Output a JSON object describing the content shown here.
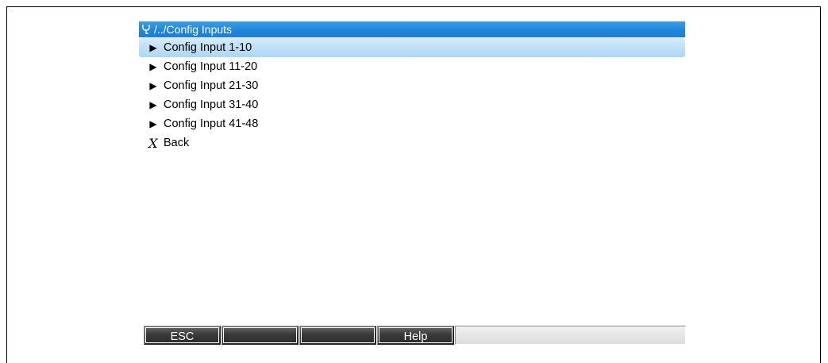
{
  "header": {
    "path": "/../Config Inputs",
    "icon": "wrench-icon"
  },
  "menu": {
    "items": [
      {
        "label": "Config Input 1-10",
        "icon": "submenu-arrow-icon",
        "selected": true
      },
      {
        "label": "Config Input 11-20",
        "icon": "submenu-arrow-icon",
        "selected": false
      },
      {
        "label": "Config Input 21-30",
        "icon": "submenu-arrow-icon",
        "selected": false
      },
      {
        "label": "Config Input 31-40",
        "icon": "submenu-arrow-icon",
        "selected": false
      },
      {
        "label": "Config Input 41-48",
        "icon": "submenu-arrow-icon",
        "selected": false
      },
      {
        "label": "Back",
        "icon": "back-x-icon",
        "selected": false
      }
    ]
  },
  "softkeys": {
    "key1": "ESC",
    "key2": "",
    "key3": "",
    "key4": "Help",
    "info": ""
  },
  "colors": {
    "title_bar": "#1f86dc",
    "selected_row": "#bfe0f7",
    "softkey": "#3b3b3b"
  }
}
